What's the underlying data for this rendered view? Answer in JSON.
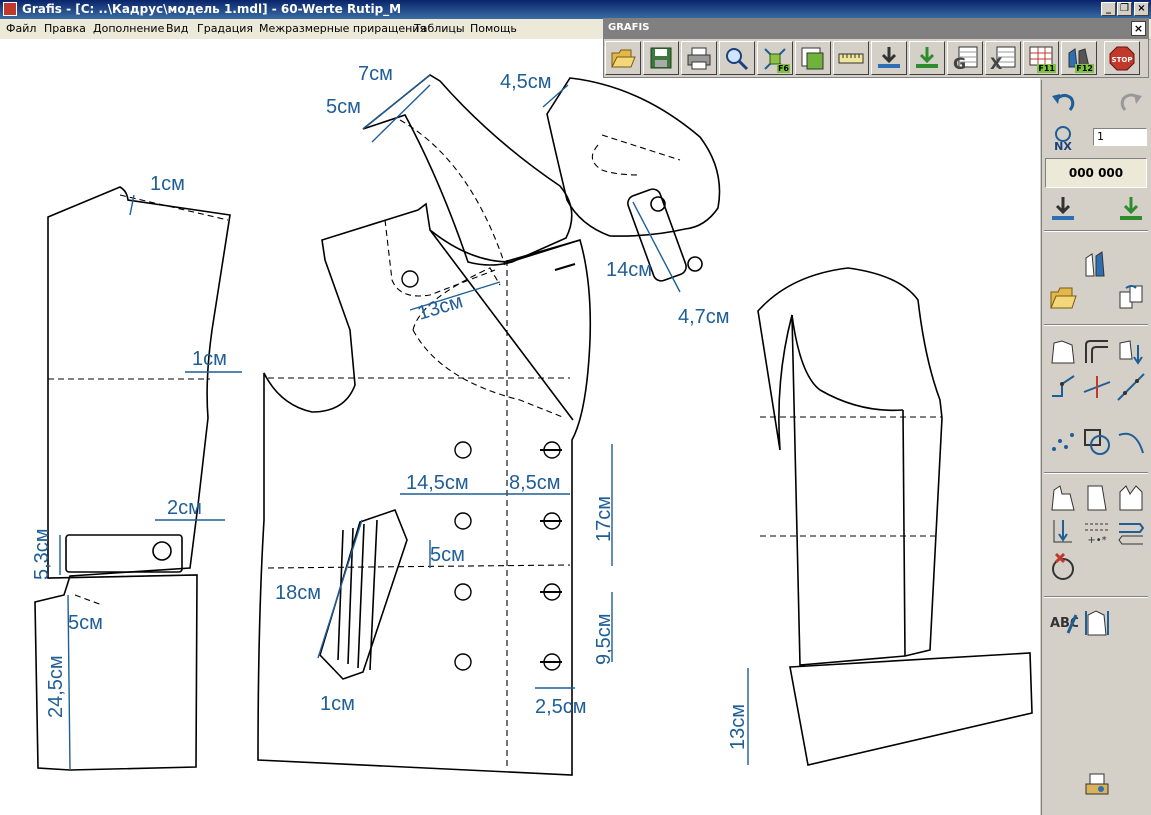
{
  "window": {
    "title": "Grafis - [C: ..\\Кадрус\\модель 1.mdl] - 60-Werte Rutip_M",
    "minimize": "_",
    "restore": "❐",
    "close": "×"
  },
  "menu": [
    "Файл",
    "Правка",
    "Дополнение",
    "Вид",
    "Градация",
    "Межразмерные приращения",
    "Таблицы",
    "Помощь"
  ],
  "toolbar": {
    "title": "GRAFIS",
    "close": "×",
    "buttons": [
      {
        "icon": "open-folder-icon"
      },
      {
        "icon": "save-disk-icon"
      },
      {
        "icon": "printer-icon"
      },
      {
        "icon": "zoom-magnifier-icon"
      },
      {
        "icon": "fit-view-icon",
        "label": "F6"
      },
      {
        "icon": "layers-icon"
      },
      {
        "icon": "measure-tape-icon"
      },
      {
        "icon": "download-arrow-icon"
      },
      {
        "icon": "download-green-icon"
      },
      {
        "icon": "size-table-icon"
      },
      {
        "icon": "table-x-icon"
      },
      {
        "icon": "grid-table-icon",
        "label": "F11"
      },
      {
        "icon": "model-parts-icon",
        "label": "F12"
      },
      {
        "icon": "stop-icon",
        "label": "STOP"
      }
    ]
  },
  "panel": {
    "nx_value": "1",
    "nx_label": "NX",
    "counter": "000 000",
    "buttons": [
      "undo-icon",
      "redo-icon",
      "nx-icon",
      "download-icon",
      "download-green-icon",
      "part-shapes-icon",
      "open-folder-icon",
      "piece-swap-icon",
      "polygon-icon",
      "parallel-line-icon",
      "piece-arrow-icon",
      "point-line-icon",
      "intersection-icon",
      "diagonal-line-icon",
      "points-icon",
      "circle-square-icon",
      "curve-icon",
      "piece-outline-icon",
      "rectangle-piece-icon",
      "collar-piece-icon",
      "dart-icon",
      "dashed-lines-icon",
      "notch-icon",
      "delete-circle-icon",
      "spell-check-icon",
      "template-icon",
      "plotter-icon"
    ]
  },
  "drawing": {
    "dimensions": [
      "7см",
      "5см",
      "4,5см",
      "1см",
      "13см",
      "14см",
      "4,7см",
      "1см",
      "2см",
      "5,3см",
      "5см",
      "24,5см",
      "14,5см",
      "8,5см",
      "17см",
      "5см",
      "18см",
      "9,5см",
      "1см",
      "2,5см",
      "13см"
    ]
  }
}
